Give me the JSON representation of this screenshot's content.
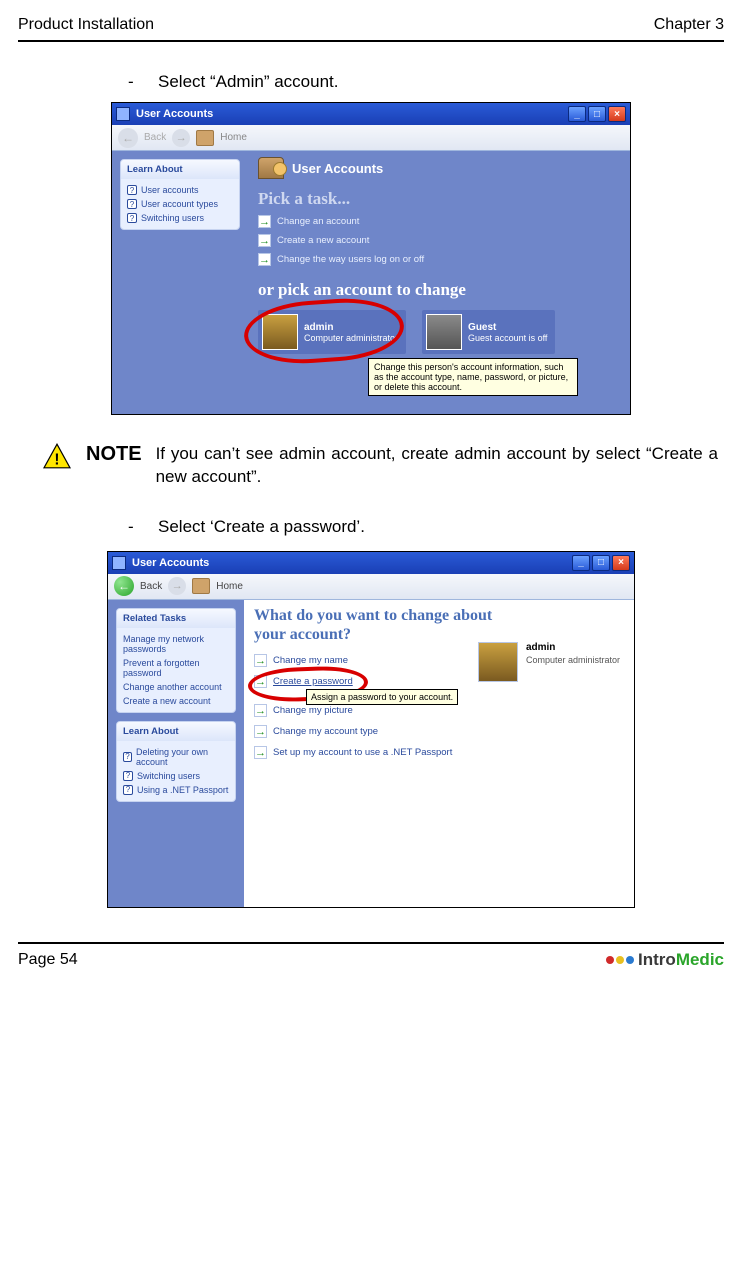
{
  "header": {
    "left": "Product Installation",
    "right": "Chapter 3"
  },
  "bullet1": "Select “Admin” account.",
  "bullet2": "Select ‘Create a password’.",
  "note": {
    "label": "NOTE",
    "text": "If you can’t see admin account, create admin account by select “Create a new account”."
  },
  "footer": {
    "page": "Page 54",
    "brand_dark": "Intro",
    "brand_green": "Medic"
  },
  "shot1": {
    "title": "User Accounts",
    "toolbar": {
      "back": "Back",
      "fwd": "",
      "home": "Home"
    },
    "learn_about_title": "Learn About",
    "learn_about": [
      "User accounts",
      "User account types",
      "Switching users"
    ],
    "main_title": "User Accounts",
    "pick_task": "Pick a task...",
    "tasks": [
      "Change an account",
      "Create a new account",
      "Change the way users log on or off"
    ],
    "or_pick": "or pick an account to change",
    "admin": {
      "name": "admin",
      "role": "Computer administrator"
    },
    "guest": {
      "name": "Guest",
      "role": "Guest account is off"
    },
    "tooltip": "Change this person's account information, such as the account type, name, password, or picture, or delete this account."
  },
  "shot2": {
    "title": "User Accounts",
    "toolbar": {
      "back": "Back",
      "home": "Home"
    },
    "related_title": "Related Tasks",
    "related": [
      "Manage my network passwords",
      "Prevent a forgotten password",
      "Change another account",
      "Create a new account"
    ],
    "learn_about_title": "Learn About",
    "learn_about": [
      "Deleting your own account",
      "Switching users",
      "Using a .NET Passport"
    ],
    "heading": "What do you want to change about your account?",
    "tasks": [
      "Change my name",
      "Create a password",
      "Change my picture",
      "Change my account type",
      "Set up my account to use a .NET Passport"
    ],
    "tooltip": "Assign a password to your account.",
    "admin": {
      "name": "admin",
      "role": "Computer administrator"
    }
  }
}
